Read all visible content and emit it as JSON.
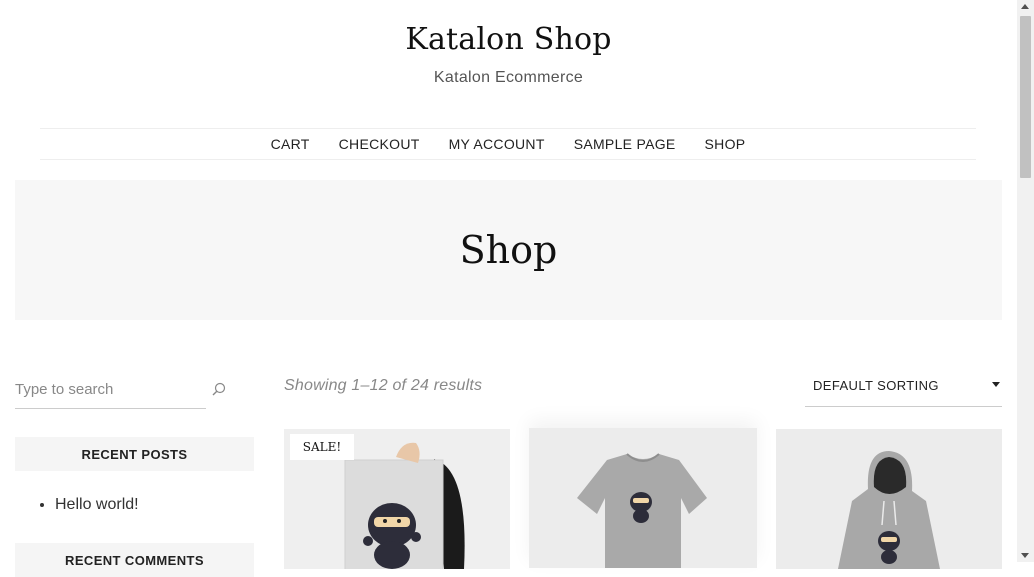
{
  "site": {
    "title": "Katalon Shop",
    "tagline": "Katalon Ecommerce"
  },
  "nav": {
    "items": [
      {
        "label": "CART"
      },
      {
        "label": "CHECKOUT"
      },
      {
        "label": "MY ACCOUNT"
      },
      {
        "label": "SAMPLE PAGE"
      },
      {
        "label": "SHOP"
      }
    ]
  },
  "hero": {
    "title": "Shop"
  },
  "sidebar": {
    "search": {
      "placeholder": "Type to search",
      "icon": "search-icon"
    },
    "recent_posts": {
      "title": "RECENT POSTS",
      "items": [
        {
          "label": "Hello world!"
        }
      ]
    },
    "recent_comments": {
      "title": "RECENT COMMENTS"
    }
  },
  "shop": {
    "result_count": "Showing 1–12 of 24 results",
    "sorting": {
      "selected": "DEFAULT SORTING",
      "icon": "chevron-down-icon"
    },
    "products": [
      {
        "badge": "SALE!",
        "image": "poster-ninja-image"
      },
      {
        "image": "tshirt-ninja-image"
      },
      {
        "image": "hoodie-ninja-image"
      }
    ]
  },
  "colors": {
    "hero_bg": "#f7f7f7",
    "widget_bg": "#f5f5f5",
    "text": "#222222",
    "muted": "#888888"
  }
}
